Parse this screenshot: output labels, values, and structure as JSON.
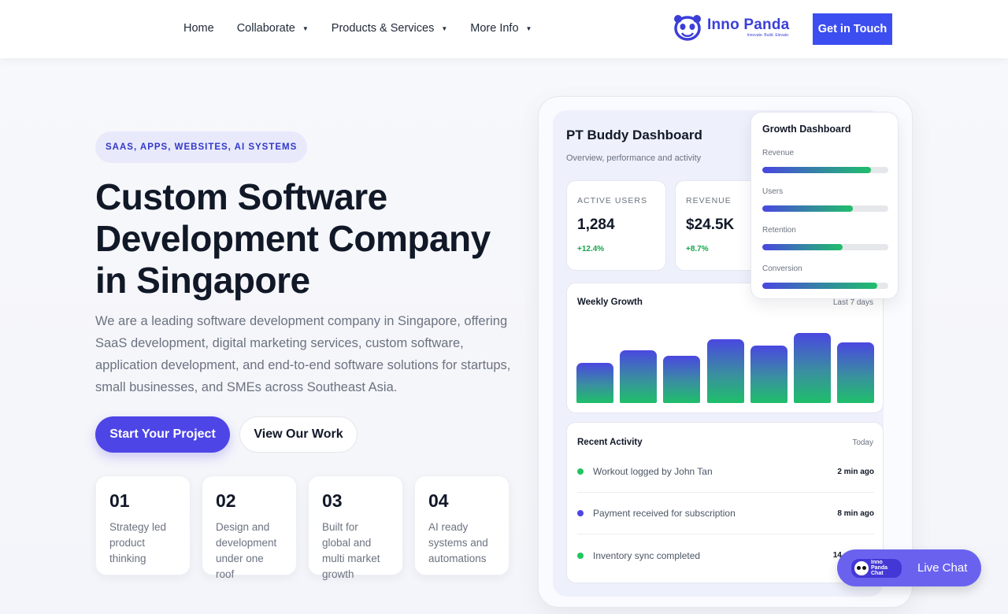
{
  "header": {
    "nav": [
      {
        "label": "Home",
        "has_caret": false
      },
      {
        "label": "Collaborate",
        "has_caret": true
      },
      {
        "label": "Products & Services",
        "has_caret": true
      },
      {
        "label": "More Info",
        "has_caret": true
      }
    ],
    "logo": {
      "name": "Inno Panda",
      "tagline": "Innovate. Build. Elevate."
    },
    "cta_label": "Get in Touch"
  },
  "hero": {
    "badge": "SAAS, APPS, WEBSITES, AI SYSTEMS",
    "title": "Custom Software Development Company in Singapore",
    "description": "We are a leading software development company in Singapore, offering SaaS development, digital marketing services, custom software, application development, and end-to-end software solutions for startups, small businesses, and SMEs across Southeast Asia.",
    "primary_button": "Start Your Project",
    "secondary_button": "View Our Work",
    "features": [
      {
        "num": "01",
        "text": "Strategy led product thinking"
      },
      {
        "num": "02",
        "text": "Design and development under one roof"
      },
      {
        "num": "03",
        "text": "Built for global and multi market growth"
      },
      {
        "num": "04",
        "text": "AI ready systems and automations"
      }
    ]
  },
  "dashboard": {
    "title": "PT Buddy Dashboard",
    "subtitle": "Overview, performance and activity",
    "stats": [
      {
        "label": "ACTIVE USERS",
        "value": "1,284",
        "delta": "+12.4%"
      },
      {
        "label": "REVENUE",
        "value": "$24.5K",
        "delta": "+8.7%"
      }
    ],
    "weekly": {
      "title": "Weekly Growth",
      "range": "Last 7 days",
      "bars": [
        0.51,
        0.67,
        0.6,
        0.81,
        0.73,
        0.89,
        0.77
      ]
    },
    "activity": {
      "title": "Recent Activity",
      "range": "Today",
      "items": [
        {
          "text": "Workout logged by John Tan",
          "time": "2 min ago",
          "color": "#22c55e"
        },
        {
          "text": "Payment received for subscription",
          "time": "8 min ago",
          "color": "#4f46e5"
        },
        {
          "text": "Inventory sync completed",
          "time": "14 min ago",
          "color": "#22c55e"
        }
      ]
    },
    "growth": {
      "title": "Growth Dashboard",
      "metrics": [
        {
          "label": "Revenue",
          "level": 0.86
        },
        {
          "label": "Users",
          "level": 0.72
        },
        {
          "label": "Retention",
          "level": 0.64
        },
        {
          "label": "Conversion",
          "level": 0.91
        }
      ]
    }
  },
  "livechat": {
    "logo_text": "Inno Panda Chat",
    "label": "Live Chat"
  },
  "colors": {
    "accent": "#3d4ef0",
    "primary_button": "#4e45e6",
    "positive": "#16a34a"
  }
}
